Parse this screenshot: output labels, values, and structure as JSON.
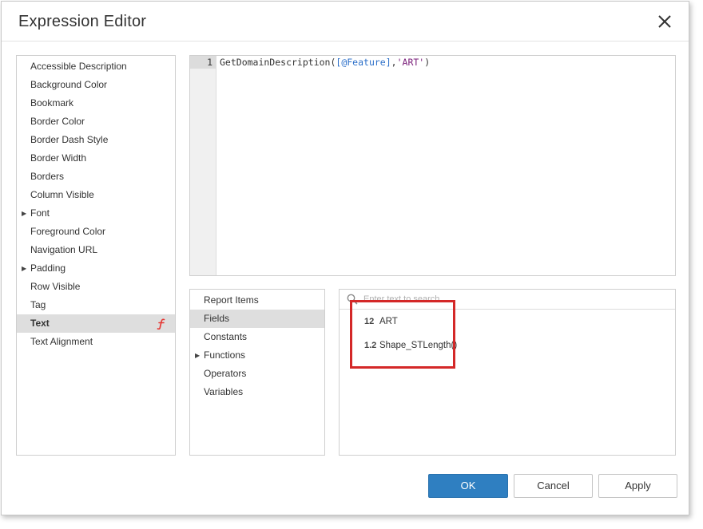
{
  "dialog": {
    "title": "Expression Editor"
  },
  "properties": [
    {
      "label": "Accessible Description",
      "expandable": false
    },
    {
      "label": "Background Color",
      "expandable": false
    },
    {
      "label": "Bookmark",
      "expandable": false
    },
    {
      "label": "Border Color",
      "expandable": false
    },
    {
      "label": "Border Dash Style",
      "expandable": false
    },
    {
      "label": "Border Width",
      "expandable": false
    },
    {
      "label": "Borders",
      "expandable": false
    },
    {
      "label": "Column Visible",
      "expandable": false
    },
    {
      "label": "Font",
      "expandable": true
    },
    {
      "label": "Foreground Color",
      "expandable": false
    },
    {
      "label": "Navigation URL",
      "expandable": false
    },
    {
      "label": "Padding",
      "expandable": true
    },
    {
      "label": "Row Visible",
      "expandable": false
    },
    {
      "label": "Tag",
      "expandable": false
    },
    {
      "label": "Text",
      "expandable": false,
      "selected": true,
      "has_expression": true
    },
    {
      "label": "Text Alignment",
      "expandable": false
    }
  ],
  "editor": {
    "line_number": "1",
    "code": {
      "func": "GetDomainDescription(",
      "field": "[@Feature]",
      "sep": ",",
      "string": "'ART'",
      "close": ")"
    }
  },
  "categories": [
    {
      "label": "Report Items",
      "expandable": false
    },
    {
      "label": "Fields",
      "expandable": false,
      "selected": true
    },
    {
      "label": "Constants",
      "expandable": false
    },
    {
      "label": "Functions",
      "expandable": true
    },
    {
      "label": "Operators",
      "expandable": false
    },
    {
      "label": "Variables",
      "expandable": false
    }
  ],
  "search": {
    "placeholder": "Enter text to search..."
  },
  "fields": [
    {
      "type": "12",
      "name": "ART"
    },
    {
      "type": "1.2",
      "name": "Shape_STLength()"
    }
  ],
  "buttons": {
    "ok": "OK",
    "cancel": "Cancel",
    "apply": "Apply"
  },
  "colors": {
    "primary_button": "#2f7fc1",
    "highlight": "#d42828",
    "expression_icon": "#e53935"
  }
}
